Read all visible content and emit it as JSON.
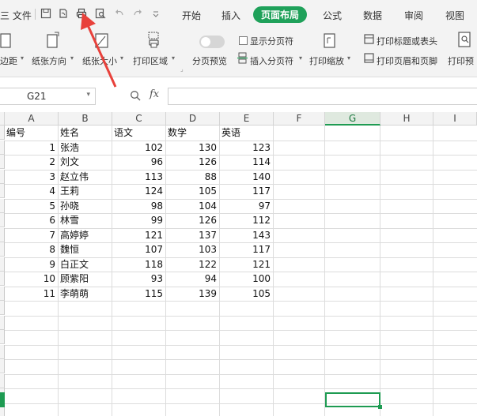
{
  "menubar": {
    "file_label": "三 文件",
    "tabs": [
      {
        "label": "开始"
      },
      {
        "label": "插入"
      },
      {
        "label": "页面布局"
      },
      {
        "label": "公式"
      },
      {
        "label": "数据"
      },
      {
        "label": "审阅"
      },
      {
        "label": "视图"
      }
    ]
  },
  "ribbon": {
    "margin_label": "边距",
    "orientation_label": "纸张方向",
    "size_label": "纸张大小",
    "print_area_label": "打印区域",
    "page_preview_label": "分页预览",
    "show_page_break_label": "显示分页符",
    "insert_page_break_label": "插入分页符",
    "print_scale_label": "打印缩放",
    "print_titles_label": "打印标题或表头",
    "header_footer_label": "打印页眉和页脚",
    "print_preview_label": "打印预"
  },
  "formula_bar": {
    "cell_ref": "G21",
    "fx_label": "fx",
    "formula_value": ""
  },
  "sheet": {
    "columns": [
      "A",
      "B",
      "C",
      "D",
      "E",
      "F",
      "G",
      "H",
      "I"
    ],
    "selected_column": "G",
    "header_row": [
      "编号",
      "姓名",
      "语文",
      "数学",
      "英语"
    ],
    "rows": [
      {
        "id": "1",
        "name": "张浩",
        "chinese": "102",
        "math": "130",
        "english": "123"
      },
      {
        "id": "2",
        "name": "刘文",
        "chinese": "96",
        "math": "126",
        "english": "114"
      },
      {
        "id": "3",
        "name": "赵立伟",
        "chinese": "113",
        "math": "88",
        "english": "140"
      },
      {
        "id": "4",
        "name": "王莉",
        "chinese": "124",
        "math": "105",
        "english": "117"
      },
      {
        "id": "5",
        "name": "孙晓",
        "chinese": "98",
        "math": "104",
        "english": "97"
      },
      {
        "id": "6",
        "name": "林雪",
        "chinese": "99",
        "math": "126",
        "english": "112"
      },
      {
        "id": "7",
        "name": "高婷婷",
        "chinese": "121",
        "math": "137",
        "english": "143"
      },
      {
        "id": "8",
        "name": "魏恒",
        "chinese": "107",
        "math": "103",
        "english": "117"
      },
      {
        "id": "9",
        "name": "白正文",
        "chinese": "118",
        "math": "122",
        "english": "121"
      },
      {
        "id": "10",
        "name": "顾紫阳",
        "chinese": "93",
        "math": "94",
        "english": "100"
      },
      {
        "id": "11",
        "name": "李萌萌",
        "chinese": "115",
        "math": "139",
        "english": "105"
      }
    ]
  },
  "colors": {
    "accent": "#1fa15a",
    "annotation_arrow": "#e8413b"
  }
}
